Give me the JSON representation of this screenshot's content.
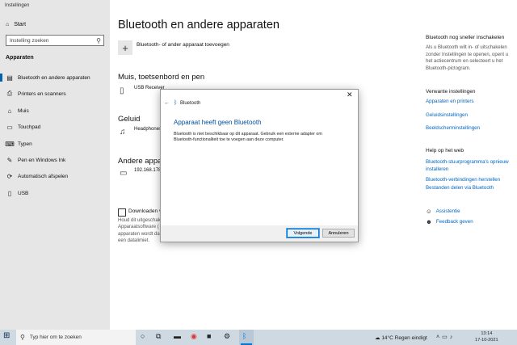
{
  "window": {
    "title": "Instellingen"
  },
  "sidebar": {
    "home_label": "Start",
    "search_placeholder": "Instelling zoeken",
    "section": "Apparaten",
    "items": [
      {
        "label": "Bluetooth en andere apparaten",
        "icon": "bluetooth-devices-icon"
      },
      {
        "label": "Printers en scanners",
        "icon": "printer-icon"
      },
      {
        "label": "Muis",
        "icon": "mouse-icon"
      },
      {
        "label": "Touchpad",
        "icon": "touchpad-icon"
      },
      {
        "label": "Typen",
        "icon": "keyboard-icon"
      },
      {
        "label": "Pen en Windows Ink",
        "icon": "pen-icon"
      },
      {
        "label": "Automatisch afspelen",
        "icon": "autoplay-icon"
      },
      {
        "label": "USB",
        "icon": "usb-icon"
      }
    ]
  },
  "main": {
    "title": "Bluetooth en andere apparaten",
    "add_label": "Bluetooth- of ander apparaat toevoegen",
    "sections": {
      "mouse": {
        "heading": "Muis, toetsenbord en pen",
        "device": "USB Receiver"
      },
      "audio": {
        "heading": "Geluid",
        "device": "Headphones"
      },
      "other": {
        "heading": "Andere appar",
        "device": "192.168.178.1"
      }
    },
    "download": {
      "label": "Downloaden vi",
      "desc_lines": [
        "Houd dit uitgeschak",
        "Apparaatsoftware (",
        "apparaten wordt da",
        "een datalimiet."
      ]
    }
  },
  "right": {
    "faster_heading": "Bluetooth nog sneller inschakelen",
    "faster_text": "Als u Bluetooth wilt in- of uitschakelen zonder Instellingen te openen, opent u het actiecentrum en selecteert u het Bluetooth-pictogram.",
    "related_heading": "Verwante instellingen",
    "related_links": [
      "Apparaten en printers",
      "Geluidsinstellingen",
      "Beeldscherminstellingen"
    ],
    "help_heading": "Help op het web",
    "help_links": [
      "Bluetooth-stuurprogramma's opnieuw installeren",
      "Bluetooth-verbindingen herstellen",
      "Bestanden delen via Bluetooth"
    ],
    "assist": "Assistentie",
    "feedback": "Feedback geven"
  },
  "dialog": {
    "title": "Bluetooth",
    "heading": "Apparaat heeft geen Bluetooth",
    "message": "Bluetooth is niet beschikbaar op dit apparaat. Gebruik een externe adapter om Bluetooth-functionaliteit toe te voegen aan deze computer.",
    "next_label": "Volgende",
    "cancel_label": "Annuleren"
  },
  "taskbar": {
    "search_placeholder": "Typ hier om te zoeken",
    "weather": "14°C  Regen eindigt",
    "time": "13:14",
    "date": "17-10-2021"
  },
  "colors": {
    "accent": "#0067c0",
    "sidebar_bg": "#e6e6e6",
    "taskbar_bg": "#cfd9e2"
  }
}
